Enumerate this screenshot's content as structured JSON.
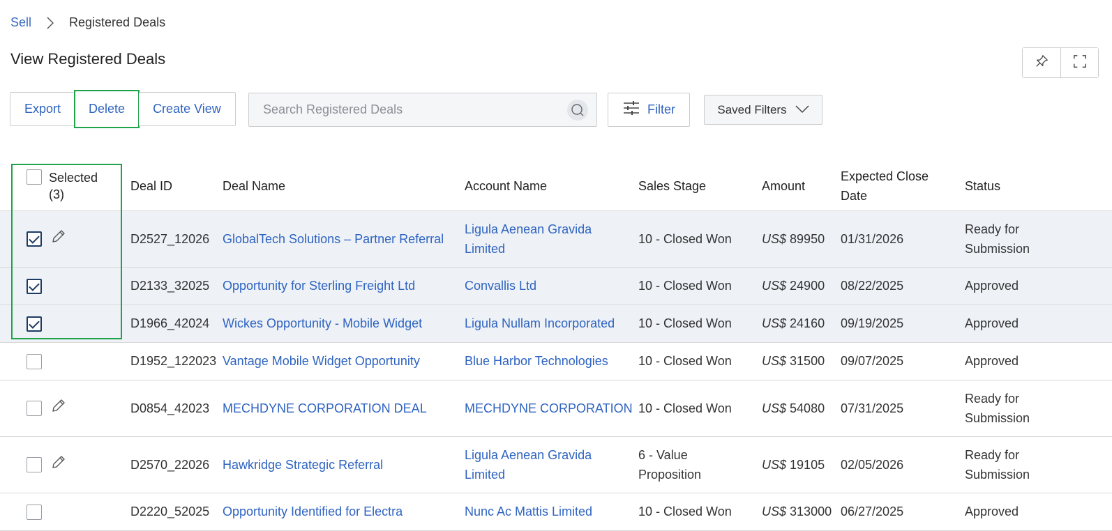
{
  "breadcrumb": {
    "parent": "Sell",
    "current": "Registered Deals"
  },
  "page_title": "View Registered Deals",
  "toolbar": {
    "export_label": "Export",
    "delete_label": "Delete",
    "create_view_label": "Create View",
    "search_placeholder": "Search Registered Deals",
    "filter_label": "Filter",
    "saved_filters_label": "Saved Filters"
  },
  "icons": {
    "pin": "pin-icon",
    "fullscreen": "expand-icon",
    "search": "search-icon",
    "filter": "sliders-icon",
    "dropdown": "chevron-down-icon",
    "edit": "pencil-icon"
  },
  "colors": {
    "link": "#2e63c0",
    "highlight": "#1fa34a",
    "selected_row": "#eef2f7"
  },
  "table": {
    "headers": {
      "selected": "Selected",
      "selected_count": "(3)",
      "deal_id": "Deal ID",
      "deal_name": "Deal Name",
      "account_name": "Account Name",
      "sales_stage": "Sales Stage",
      "amount": "Amount",
      "close_date": "Expected Close Date",
      "status": "Status"
    },
    "currency": "US$",
    "rows": [
      {
        "checked": true,
        "editable": true,
        "deal_id": "D2527_12026",
        "deal_name": "GlobalTech Solutions – Partner Referral",
        "account": "Ligula Aenean Gravida Limited",
        "stage": "10 - Closed Won",
        "amount": "89950",
        "close_date": "01/31/2026",
        "status": "Ready for Submission"
      },
      {
        "checked": true,
        "editable": false,
        "deal_id": "D2133_32025",
        "deal_name": "Opportunity for Sterling Freight Ltd",
        "account": "Convallis Ltd",
        "stage": "10 - Closed Won",
        "amount": "24900",
        "close_date": "08/22/2025",
        "status": "Approved"
      },
      {
        "checked": true,
        "editable": false,
        "deal_id": "D1966_42024",
        "deal_name": "Wickes Opportunity - Mobile Widget",
        "account": "Ligula Nullam Incorporated",
        "stage": "10 - Closed Won",
        "amount": "24160",
        "close_date": "09/19/2025",
        "status": "Approved"
      },
      {
        "checked": false,
        "editable": false,
        "deal_id": "D1952_122023",
        "deal_name": "Vantage Mobile Widget Opportunity",
        "account": "Blue Harbor Technologies",
        "stage": "10 - Closed Won",
        "amount": "31500",
        "close_date": "09/07/2025",
        "status": "Approved"
      },
      {
        "checked": false,
        "editable": true,
        "deal_id": "D0854_42023",
        "deal_name": "MECHDYNE CORPORATION DEAL",
        "account": "MECHDYNE CORPORATION",
        "stage": "10 - Closed Won",
        "amount": "54080",
        "close_date": "07/31/2025",
        "status": "Ready for Submission"
      },
      {
        "checked": false,
        "editable": true,
        "deal_id": "D2570_22026",
        "deal_name": "Hawkridge Strategic Referral",
        "account": "Ligula Aenean Gravida Limited",
        "stage": "6 - Value Proposition",
        "amount": "19105",
        "close_date": "02/05/2026",
        "status": "Ready for Submission"
      },
      {
        "checked": false,
        "editable": false,
        "deal_id": "D2220_52025",
        "deal_name": "Opportunity Identified for Electra",
        "account": "Nunc Ac Mattis Limited",
        "stage": "10 - Closed Won",
        "amount": "313000",
        "close_date": "06/27/2025",
        "status": "Approved"
      }
    ]
  }
}
